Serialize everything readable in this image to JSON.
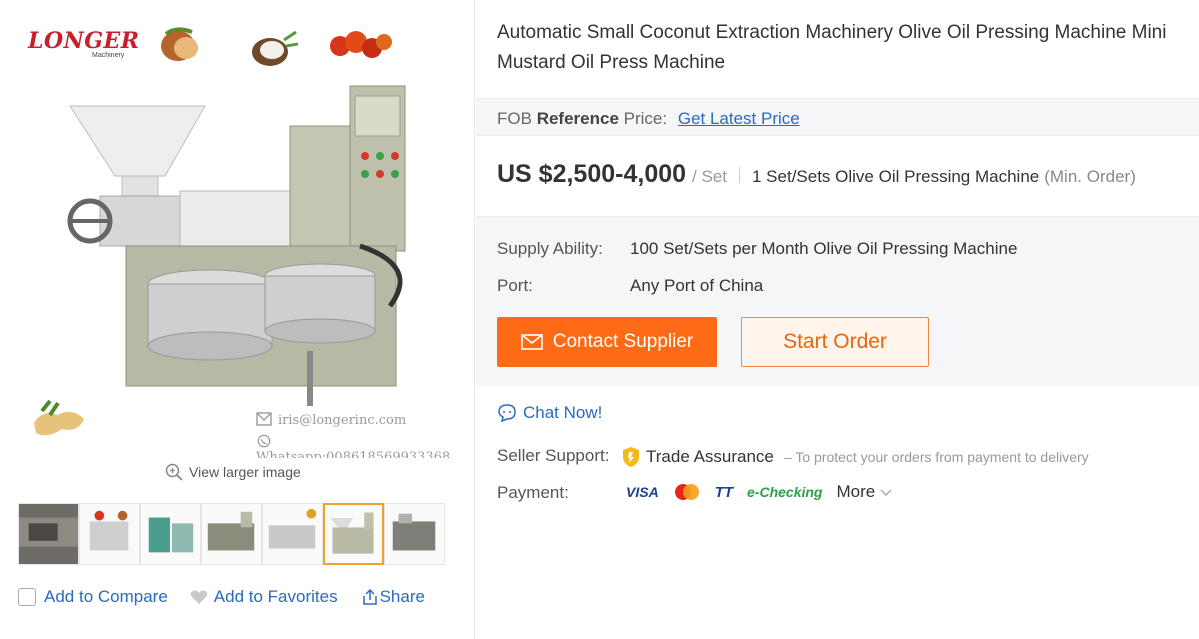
{
  "gallery": {
    "logo_text": "LONGER",
    "logo_sub": "Machinery",
    "watermark_email": "iris@longerinc.com",
    "watermark_whatsapp": "Whatsapp:008618569933368",
    "view_larger_label": "View larger image",
    "thumbnail_count": 7,
    "active_thumbnail": 6
  },
  "actions": {
    "compare_label": "Add to Compare",
    "favorites_label": "Add to Favorites",
    "share_label": "Share"
  },
  "product": {
    "title": "Automatic Small Coconut Extraction Machinery Olive Oil Pressing Machine Mini Mustard Oil Press Machine",
    "ref_prefix": "FOB",
    "ref_bold": "Reference",
    "ref_suffix": "Price:",
    "ref_link": "Get Latest Price",
    "price": "US $2,500-4,000",
    "price_unit": "/ Set",
    "min_order": "1 Set/Sets Olive Oil Pressing Machine",
    "min_order_tag": "(Min. Order)"
  },
  "details": {
    "supply_label": "Supply Ability:",
    "supply_value": "100 Set/Sets per Month Olive Oil Pressing Machine",
    "port_label": "Port:",
    "port_value": "Any Port of China",
    "contact_button": "Contact Supplier",
    "order_button": "Start Order"
  },
  "seller": {
    "chat_label": "Chat Now!",
    "support_label": "Seller Support:",
    "trade_assurance": "Trade Assurance",
    "trade_note": "– To protect your orders from payment to delivery",
    "payment_label": "Payment:",
    "pay_visa": "VISA",
    "pay_tt": "TT",
    "pay_echeck": "e-Checking",
    "pay_more": "More"
  },
  "colors": {
    "accent_orange": "#ff6a14",
    "link_blue": "#2a6bbf",
    "logo_red": "#c8202a"
  }
}
